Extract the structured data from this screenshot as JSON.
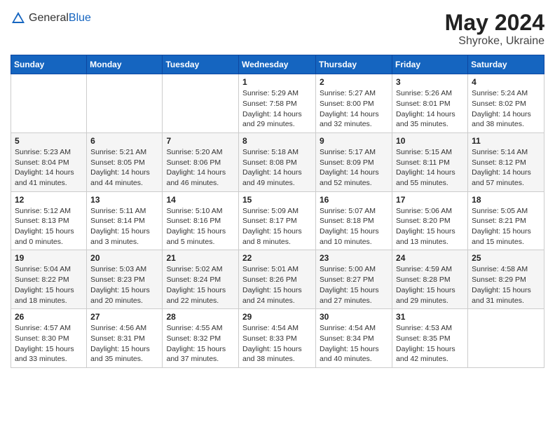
{
  "header": {
    "logo_general": "General",
    "logo_blue": "Blue",
    "month_year": "May 2024",
    "location": "Shyroke, Ukraine"
  },
  "days_of_week": [
    "Sunday",
    "Monday",
    "Tuesday",
    "Wednesday",
    "Thursday",
    "Friday",
    "Saturday"
  ],
  "weeks": [
    [
      {
        "num": "",
        "sunrise": "",
        "sunset": "",
        "daylight": ""
      },
      {
        "num": "",
        "sunrise": "",
        "sunset": "",
        "daylight": ""
      },
      {
        "num": "",
        "sunrise": "",
        "sunset": "",
        "daylight": ""
      },
      {
        "num": "1",
        "sunrise": "5:29 AM",
        "sunset": "7:58 PM",
        "daylight": "14 hours and 29 minutes."
      },
      {
        "num": "2",
        "sunrise": "5:27 AM",
        "sunset": "8:00 PM",
        "daylight": "14 hours and 32 minutes."
      },
      {
        "num": "3",
        "sunrise": "5:26 AM",
        "sunset": "8:01 PM",
        "daylight": "14 hours and 35 minutes."
      },
      {
        "num": "4",
        "sunrise": "5:24 AM",
        "sunset": "8:02 PM",
        "daylight": "14 hours and 38 minutes."
      }
    ],
    [
      {
        "num": "5",
        "sunrise": "5:23 AM",
        "sunset": "8:04 PM",
        "daylight": "14 hours and 41 minutes."
      },
      {
        "num": "6",
        "sunrise": "5:21 AM",
        "sunset": "8:05 PM",
        "daylight": "14 hours and 44 minutes."
      },
      {
        "num": "7",
        "sunrise": "5:20 AM",
        "sunset": "8:06 PM",
        "daylight": "14 hours and 46 minutes."
      },
      {
        "num": "8",
        "sunrise": "5:18 AM",
        "sunset": "8:08 PM",
        "daylight": "14 hours and 49 minutes."
      },
      {
        "num": "9",
        "sunrise": "5:17 AM",
        "sunset": "8:09 PM",
        "daylight": "14 hours and 52 minutes."
      },
      {
        "num": "10",
        "sunrise": "5:15 AM",
        "sunset": "8:11 PM",
        "daylight": "14 hours and 55 minutes."
      },
      {
        "num": "11",
        "sunrise": "5:14 AM",
        "sunset": "8:12 PM",
        "daylight": "14 hours and 57 minutes."
      }
    ],
    [
      {
        "num": "12",
        "sunrise": "5:12 AM",
        "sunset": "8:13 PM",
        "daylight": "15 hours and 0 minutes."
      },
      {
        "num": "13",
        "sunrise": "5:11 AM",
        "sunset": "8:14 PM",
        "daylight": "15 hours and 3 minutes."
      },
      {
        "num": "14",
        "sunrise": "5:10 AM",
        "sunset": "8:16 PM",
        "daylight": "15 hours and 5 minutes."
      },
      {
        "num": "15",
        "sunrise": "5:09 AM",
        "sunset": "8:17 PM",
        "daylight": "15 hours and 8 minutes."
      },
      {
        "num": "16",
        "sunrise": "5:07 AM",
        "sunset": "8:18 PM",
        "daylight": "15 hours and 10 minutes."
      },
      {
        "num": "17",
        "sunrise": "5:06 AM",
        "sunset": "8:20 PM",
        "daylight": "15 hours and 13 minutes."
      },
      {
        "num": "18",
        "sunrise": "5:05 AM",
        "sunset": "8:21 PM",
        "daylight": "15 hours and 15 minutes."
      }
    ],
    [
      {
        "num": "19",
        "sunrise": "5:04 AM",
        "sunset": "8:22 PM",
        "daylight": "15 hours and 18 minutes."
      },
      {
        "num": "20",
        "sunrise": "5:03 AM",
        "sunset": "8:23 PM",
        "daylight": "15 hours and 20 minutes."
      },
      {
        "num": "21",
        "sunrise": "5:02 AM",
        "sunset": "8:24 PM",
        "daylight": "15 hours and 22 minutes."
      },
      {
        "num": "22",
        "sunrise": "5:01 AM",
        "sunset": "8:26 PM",
        "daylight": "15 hours and 24 minutes."
      },
      {
        "num": "23",
        "sunrise": "5:00 AM",
        "sunset": "8:27 PM",
        "daylight": "15 hours and 27 minutes."
      },
      {
        "num": "24",
        "sunrise": "4:59 AM",
        "sunset": "8:28 PM",
        "daylight": "15 hours and 29 minutes."
      },
      {
        "num": "25",
        "sunrise": "4:58 AM",
        "sunset": "8:29 PM",
        "daylight": "15 hours and 31 minutes."
      }
    ],
    [
      {
        "num": "26",
        "sunrise": "4:57 AM",
        "sunset": "8:30 PM",
        "daylight": "15 hours and 33 minutes."
      },
      {
        "num": "27",
        "sunrise": "4:56 AM",
        "sunset": "8:31 PM",
        "daylight": "15 hours and 35 minutes."
      },
      {
        "num": "28",
        "sunrise": "4:55 AM",
        "sunset": "8:32 PM",
        "daylight": "15 hours and 37 minutes."
      },
      {
        "num": "29",
        "sunrise": "4:54 AM",
        "sunset": "8:33 PM",
        "daylight": "15 hours and 38 minutes."
      },
      {
        "num": "30",
        "sunrise": "4:54 AM",
        "sunset": "8:34 PM",
        "daylight": "15 hours and 40 minutes."
      },
      {
        "num": "31",
        "sunrise": "4:53 AM",
        "sunset": "8:35 PM",
        "daylight": "15 hours and 42 minutes."
      },
      {
        "num": "",
        "sunrise": "",
        "sunset": "",
        "daylight": ""
      }
    ]
  ]
}
